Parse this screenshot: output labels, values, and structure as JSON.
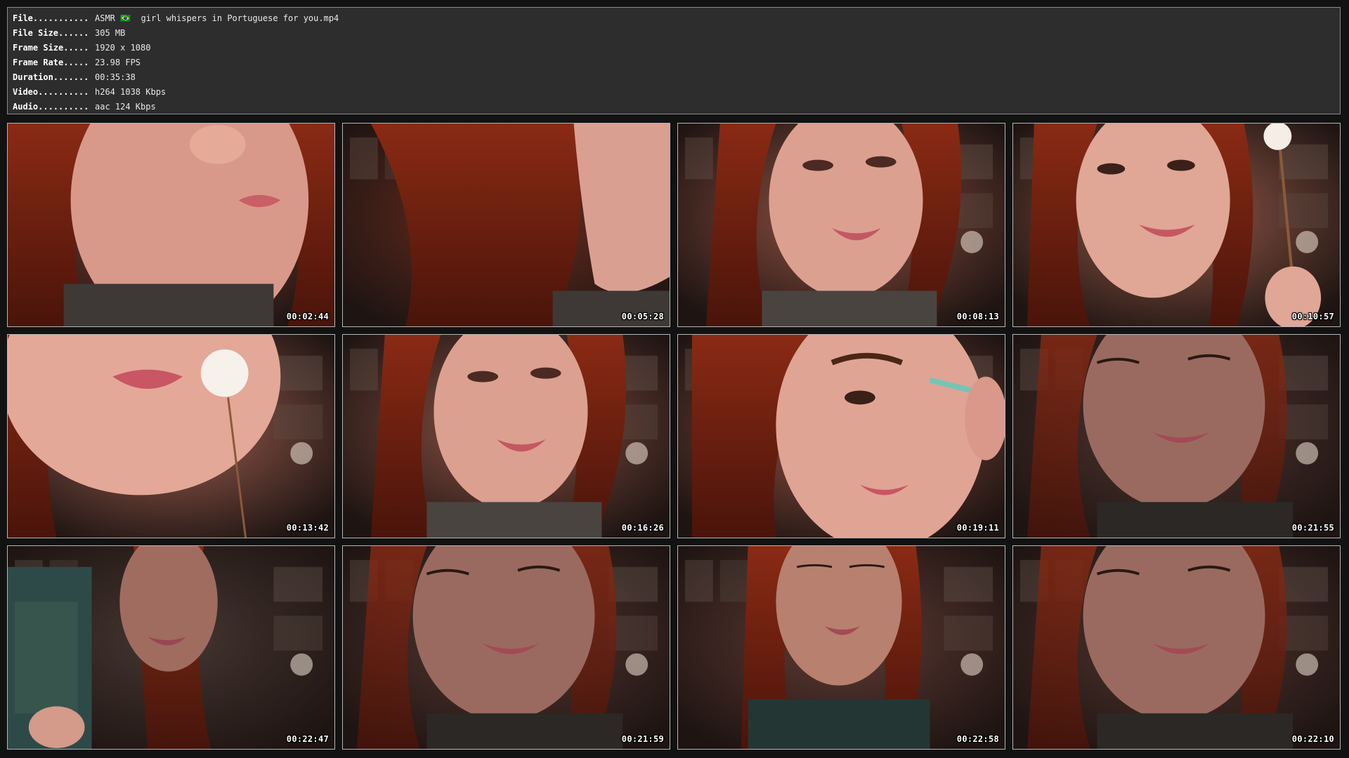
{
  "info": {
    "rows": [
      {
        "label": "File...........",
        "value": "ASMR 🇧🇷  girl whispers in Portuguese for you.mp4"
      },
      {
        "label": "File Size......",
        "value": "305 MB"
      },
      {
        "label": "Frame Size.....",
        "value": "1920 x 1080"
      },
      {
        "label": "Frame Rate.....",
        "value": "23.98 FPS"
      },
      {
        "label": "Duration.......",
        "value": "00:35:38"
      },
      {
        "label": "Video..........",
        "value": "h264 1038 Kbps"
      },
      {
        "label": "Audio..........",
        "value": "aac 124 Kbps"
      }
    ]
  },
  "thumbnails": [
    {
      "timestamp": "00:02:44",
      "scene": "closeup-lips",
      "tone": "#8e4434"
    },
    {
      "timestamp": "00:05:28",
      "scene": "hair",
      "tone": "#7a3020"
    },
    {
      "timestamp": "00:08:13",
      "scene": "face-smile",
      "tone": "#a25a48"
    },
    {
      "timestamp": "00:10:57",
      "scene": "face-brush",
      "tone": "#a86450"
    },
    {
      "timestamp": "00:13:42",
      "scene": "lips-puff",
      "tone": "#b36a5a"
    },
    {
      "timestamp": "00:16:26",
      "scene": "face-center",
      "tone": "#9a5a4a"
    },
    {
      "timestamp": "00:19:11",
      "scene": "eye-brush",
      "tone": "#a85a48"
    },
    {
      "timestamp": "00:21:55",
      "scene": "face-dim",
      "tone": "#5a3a34"
    },
    {
      "timestamp": "00:22:47",
      "scene": "book",
      "tone": "#4a3a34"
    },
    {
      "timestamp": "00:21:59",
      "scene": "face-dim2",
      "tone": "#5e3c36"
    },
    {
      "timestamp": "00:22:58",
      "scene": "face-down",
      "tone": "#6a4038"
    },
    {
      "timestamp": "00:22:10",
      "scene": "face-dim3",
      "tone": "#5c3a34"
    }
  ]
}
